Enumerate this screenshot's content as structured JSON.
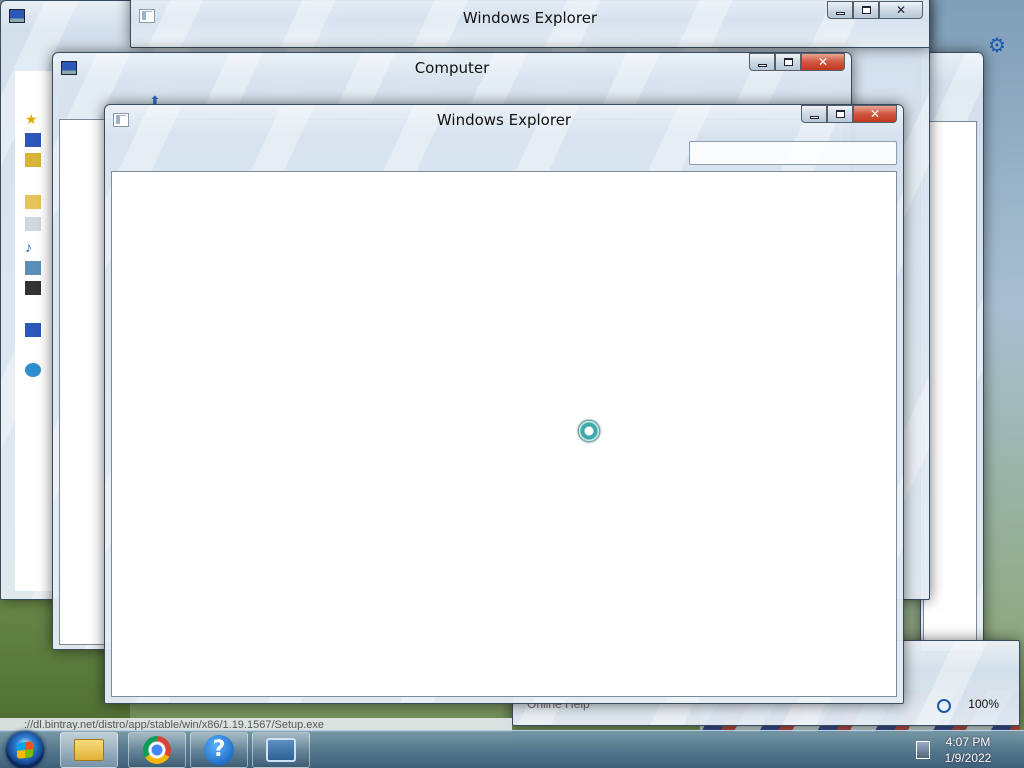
{
  "windows": {
    "back_explorer": {
      "title": "Windows Explorer"
    },
    "computer": {
      "title": "Computer"
    },
    "front_explorer": {
      "title": "Windows Explorer",
      "search_placeholder": ""
    }
  },
  "status_url": "://dl.bintray.net/distro/app/stable/win/x86/1.19.1567/Setup.exe",
  "help_tab": {
    "label": "Online Help"
  },
  "zoom": {
    "level": "100%"
  },
  "taskbar": {
    "apps": [
      {
        "name": "Windows Explorer",
        "icon": "folder-icon"
      },
      {
        "name": "Google Chrome",
        "icon": "chrome-icon"
      },
      {
        "name": "Help and Support",
        "icon": "help-icon"
      },
      {
        "name": "Remote Desktop",
        "icon": "remote-desktop-icon"
      }
    ],
    "clock": {
      "time": "4:07 PM",
      "date": "1/9/2022"
    }
  },
  "colors": {
    "close_button": "#c0381f",
    "taskbar": "#557896",
    "accent": "#1a5aa8"
  }
}
